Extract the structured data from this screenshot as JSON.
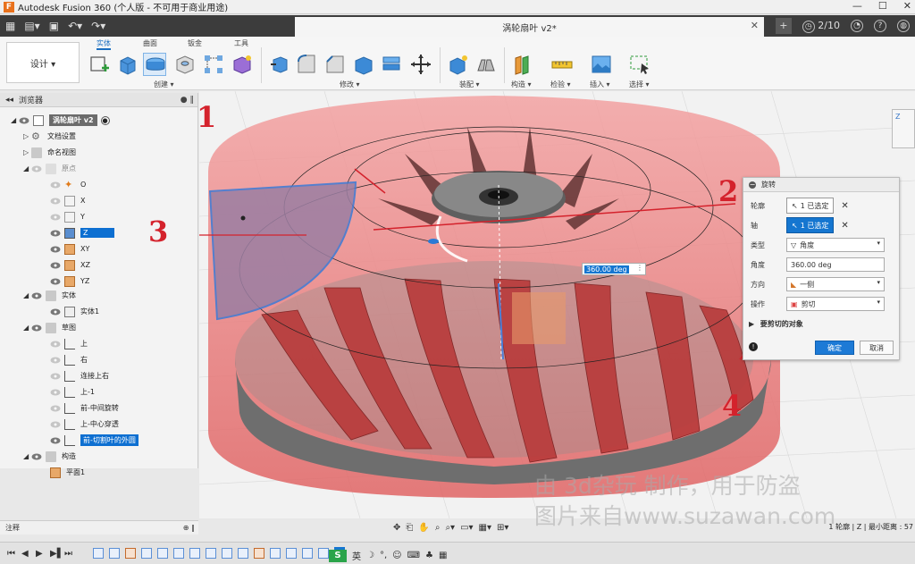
{
  "window": {
    "app_title": "Autodesk Fusion 360 (个人版 - 不可用于商业用途)",
    "doc_tab": "涡轮扇叶 v2*",
    "job_count": "2/10"
  },
  "ribbon": {
    "workspace": "设计 ▾",
    "tabs": [
      "实体",
      "曲面",
      "钣金",
      "工具"
    ],
    "groups": {
      "create": "创建 ▾",
      "modify": "修改 ▾",
      "assemble": "装配 ▾",
      "construct": "构造 ▾",
      "inspect": "检验 ▾",
      "insert": "插入 ▾",
      "select": "选择 ▾"
    }
  },
  "browser": {
    "title": "浏览器",
    "root": "涡轮扇叶 v2",
    "items": [
      {
        "label": "文档设置"
      },
      {
        "label": "命名视图"
      },
      {
        "label": "原点"
      },
      {
        "label": "O"
      },
      {
        "label": "X"
      },
      {
        "label": "Y"
      },
      {
        "label": "Z"
      },
      {
        "label": "XY"
      },
      {
        "label": "XZ"
      },
      {
        "label": "YZ"
      },
      {
        "label": "实体"
      },
      {
        "label": "实体1"
      },
      {
        "label": "草图"
      },
      {
        "label": "上"
      },
      {
        "label": "右"
      },
      {
        "label": "连接上右"
      },
      {
        "label": "上-1"
      },
      {
        "label": "前-中间旋转"
      },
      {
        "label": "上-中心穿透"
      },
      {
        "label": "前-切割叶的外圆"
      },
      {
        "label": "构造"
      },
      {
        "label": "平面1"
      }
    ]
  },
  "dialog": {
    "title": "旋转",
    "profile_label": "轮廓",
    "profile_value": "1 已选定",
    "axis_label": "轴",
    "axis_value": "1 已选定",
    "type_label": "类型",
    "type_value": "角度",
    "angle_label": "角度",
    "angle_value": "360.00 deg",
    "direction_label": "方向",
    "direction_value": "一侧",
    "operation_label": "操作",
    "operation_value": "剪切",
    "bodies_label": "要剪切的对象",
    "ok": "确定",
    "cancel": "取消"
  },
  "canvas": {
    "angle_input": "360.00 deg"
  },
  "annotations": [
    "1",
    "2",
    "3",
    "4"
  ],
  "watermark": {
    "line1": "由 3d杂玩 制作，用于防盗",
    "line2": "图片来自www.suzawan.com"
  },
  "bottom": {
    "comments": "注释",
    "status": "1 轮廓 | Z | 最小距离 : 57"
  },
  "colors": {
    "accent": "#1576d0",
    "annotation": "#d4222c",
    "cut_preview": "#e84a4a"
  }
}
